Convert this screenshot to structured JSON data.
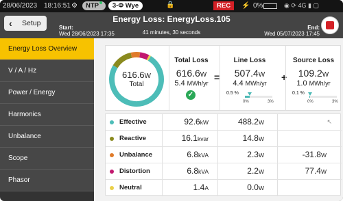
{
  "status_bar": {
    "date": "28/06/2023",
    "time": "18:16:51",
    "ntp": "NTP",
    "wiring": "3-Φ Wye",
    "rec": "REC",
    "battery_pct": "0%",
    "network": "4G"
  },
  "header": {
    "back_label": "Setup",
    "title": "Energy Loss: EnergyLoss.105",
    "start_label": "Start:",
    "start_value": "Wed 28/06/2023 17:35",
    "duration": "41 minutes, 30 seconds",
    "end_label": "End:",
    "end_value": "Wed 05/07/2023 17:45"
  },
  "sidebar": {
    "items": [
      {
        "label": "Energy Loss Overview",
        "active": true
      },
      {
        "label": "V / A / Hz"
      },
      {
        "label": "Power / Energy"
      },
      {
        "label": "Harmonics"
      },
      {
        "label": "Unbalance"
      },
      {
        "label": "Scope"
      },
      {
        "label": "Phasor"
      }
    ]
  },
  "summary": {
    "donut_value": "616.6",
    "donut_unit": "W",
    "donut_label": "Total",
    "donut_segments": [
      {
        "name": "Effective",
        "value": 92.6,
        "color": "#4dbdb8"
      },
      {
        "name": "Reactive",
        "value": 16.1,
        "color": "#8a8a1e"
      },
      {
        "name": "Unbalance",
        "value": 6.8,
        "color": "#e07b2a"
      },
      {
        "name": "Distortion",
        "value": 6.8,
        "color": "#c2186e"
      },
      {
        "name": "Neutral",
        "value": 1.4,
        "color": "#ead04a"
      }
    ],
    "total_loss": {
      "title": "Total Loss",
      "value": "616.6",
      "unit": "W",
      "energy": "5.4",
      "energy_unit": "MWh/yr"
    },
    "equals": "=",
    "plus": "+",
    "line_loss": {
      "title": "Line Loss",
      "value": "507.4",
      "unit": "W",
      "energy": "4.4",
      "energy_unit": "MWh/yr",
      "pct": "0.5 %",
      "gauge_min": "0%",
      "gauge_max": "3%",
      "gauge_level": 0.17
    },
    "source_loss": {
      "title": "Source Loss",
      "value": "109.2",
      "unit": "W",
      "energy": "1.0",
      "energy_unit": "MWh/yr",
      "pct": "0.1 %",
      "gauge_min": "0%",
      "gauge_max": "3%",
      "gauge_level": 0.03
    }
  },
  "table": {
    "rows": [
      {
        "name": "Effective",
        "color": "#4dbdb8",
        "v1": "92.6",
        "u1": "kW",
        "v2": "488.2",
        "u2": "W",
        "v3": "",
        "u3": ""
      },
      {
        "name": "Reactive",
        "color": "#8a8a1e",
        "v1": "16.1",
        "u1": "kvar",
        "v2": "14.8",
        "u2": "W",
        "v3": "",
        "u3": ""
      },
      {
        "name": "Unbalance",
        "color": "#e07b2a",
        "v1": "6.8",
        "u1": "kVA",
        "v2": "2.3",
        "u2": "W",
        "v3": "-31.8",
        "u3": "W"
      },
      {
        "name": "Distortion",
        "color": "#c2186e",
        "v1": "6.8",
        "u1": "kVA",
        "v2": "2.2",
        "u2": "W",
        "v3": "77.4",
        "u3": "W"
      },
      {
        "name": "Neutral",
        "color": "#ead04a",
        "v1": "1.4",
        "u1": "A",
        "v2": "0.0",
        "u2": "W",
        "v3": "",
        "u3": ""
      }
    ]
  }
}
